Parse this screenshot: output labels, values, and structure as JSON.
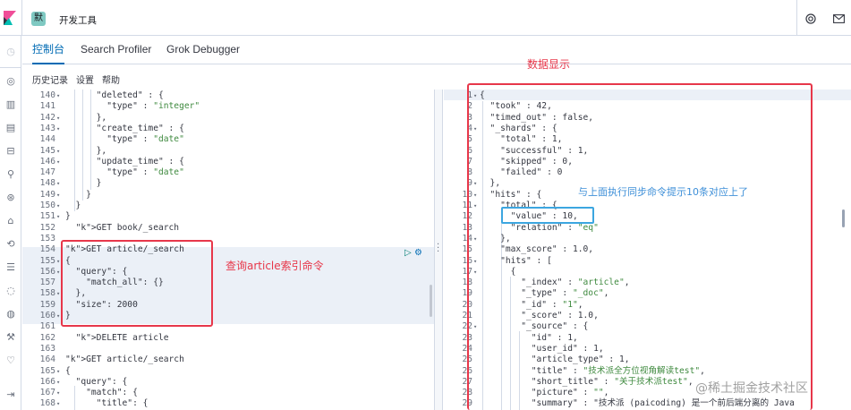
{
  "header": {
    "logo_icon": "kibana-logo-icon",
    "space_avatar": "默",
    "title": "开发工具",
    "help_icon": "help-lifebuoy-icon",
    "mail_icon": "mail-icon"
  },
  "tabs": [
    {
      "label": "控制台",
      "active": true
    },
    {
      "label": "Search Profiler",
      "active": false
    },
    {
      "label": "Grok Debugger",
      "active": false
    }
  ],
  "toolbar": {
    "history": "历史记录",
    "settings": "设置",
    "help": "帮助"
  },
  "left_editor": {
    "lines": [
      {
        "n": "140",
        "fold": true,
        "code": "      \"deleted\" : {"
      },
      {
        "n": "141",
        "fold": false,
        "code": "        \"type\" : \"integer\""
      },
      {
        "n": "142",
        "fold": true,
        "code": "      },"
      },
      {
        "n": "143",
        "fold": true,
        "code": "      \"create_time\" : {"
      },
      {
        "n": "144",
        "fold": false,
        "code": "        \"type\" : \"date\""
      },
      {
        "n": "145",
        "fold": true,
        "code": "      },"
      },
      {
        "n": "146",
        "fold": true,
        "code": "      \"update_time\" : {"
      },
      {
        "n": "147",
        "fold": false,
        "code": "        \"type\" : \"date\""
      },
      {
        "n": "148",
        "fold": true,
        "code": "      }"
      },
      {
        "n": "149",
        "fold": true,
        "code": "    }"
      },
      {
        "n": "150",
        "fold": true,
        "code": "  }"
      },
      {
        "n": "151",
        "fold": true,
        "code": "}"
      },
      {
        "n": "152",
        "fold": false,
        "code": "  GET book/_search"
      },
      {
        "n": "153",
        "fold": false,
        "code": ""
      },
      {
        "n": "154",
        "fold": false,
        "code": "GET article/_search"
      },
      {
        "n": "155",
        "fold": true,
        "code": "{"
      },
      {
        "n": "156",
        "fold": true,
        "code": "  \"query\": {"
      },
      {
        "n": "157",
        "fold": false,
        "code": "    \"match_all\": {}"
      },
      {
        "n": "158",
        "fold": true,
        "code": "  },"
      },
      {
        "n": "159",
        "fold": false,
        "code": "  \"size\": 2000"
      },
      {
        "n": "160",
        "fold": true,
        "code": "}"
      },
      {
        "n": "161",
        "fold": false,
        "code": ""
      },
      {
        "n": "162",
        "fold": false,
        "code": "  DELETE article"
      },
      {
        "n": "163",
        "fold": false,
        "code": ""
      },
      {
        "n": "164",
        "fold": false,
        "code": "GET article/_search"
      },
      {
        "n": "165",
        "fold": true,
        "code": "{"
      },
      {
        "n": "166",
        "fold": true,
        "code": "  \"query\": {"
      },
      {
        "n": "167",
        "fold": true,
        "code": "    \"match\": {"
      },
      {
        "n": "168",
        "fold": true,
        "code": "      \"title\": {"
      }
    ]
  },
  "right_editor": {
    "lines": [
      {
        "n": "1",
        "fold": true,
        "code": "{"
      },
      {
        "n": "2",
        "fold": false,
        "code": "  \"took\" : 42,"
      },
      {
        "n": "3",
        "fold": false,
        "code": "  \"timed_out\" : false,"
      },
      {
        "n": "4",
        "fold": true,
        "code": "  \"_shards\" : {"
      },
      {
        "n": "5",
        "fold": false,
        "code": "    \"total\" : 1,"
      },
      {
        "n": "6",
        "fold": false,
        "code": "    \"successful\" : 1,"
      },
      {
        "n": "7",
        "fold": false,
        "code": "    \"skipped\" : 0,"
      },
      {
        "n": "8",
        "fold": false,
        "code": "    \"failed\" : 0"
      },
      {
        "n": "9",
        "fold": true,
        "code": "  },"
      },
      {
        "n": "10",
        "fold": true,
        "code": "  \"hits\" : {"
      },
      {
        "n": "11",
        "fold": true,
        "code": "    \"total\" : {"
      },
      {
        "n": "12",
        "fold": false,
        "code": "      \"value\" : 10,"
      },
      {
        "n": "13",
        "fold": false,
        "code": "      \"relation\" : \"eq\""
      },
      {
        "n": "14",
        "fold": true,
        "code": "    },"
      },
      {
        "n": "15",
        "fold": false,
        "code": "    \"max_score\" : 1.0,"
      },
      {
        "n": "16",
        "fold": true,
        "code": "    \"hits\" : ["
      },
      {
        "n": "17",
        "fold": true,
        "code": "      {"
      },
      {
        "n": "18",
        "fold": false,
        "code": "        \"_index\" : \"article\","
      },
      {
        "n": "19",
        "fold": false,
        "code": "        \"_type\" : \"_doc\","
      },
      {
        "n": "20",
        "fold": false,
        "code": "        \"_id\" : \"1\","
      },
      {
        "n": "21",
        "fold": false,
        "code": "        \"_score\" : 1.0,"
      },
      {
        "n": "22",
        "fold": true,
        "code": "        \"_source\" : {"
      },
      {
        "n": "23",
        "fold": false,
        "code": "          \"id\" : 1,"
      },
      {
        "n": "24",
        "fold": false,
        "code": "          \"user_id\" : 1,"
      },
      {
        "n": "25",
        "fold": false,
        "code": "          \"article_type\" : 1,"
      },
      {
        "n": "26",
        "fold": false,
        "code": "          \"title\" : \"技术派全方位视角解读test\","
      },
      {
        "n": "27",
        "fold": false,
        "code": "          \"short_title\" : \"关于技术派test\","
      },
      {
        "n": "28",
        "fold": false,
        "code": "          \"picture\" : \"\","
      },
      {
        "n": "29",
        "fold": false,
        "code": "          \"summary\" : \"技术派 (paicoding) 是一个前后端分离的 Java"
      }
    ]
  },
  "annotations": {
    "data_display": "数据显示",
    "query_command": "查询article索引命令",
    "sync_note": "与上面执行同步命令提示10条对应上了"
  },
  "watermark": "@稀土掘金技术社区",
  "colors": {
    "active_tab": "#006bb4",
    "annotation_red": "#e7374a",
    "annotation_blue": "#3ca6e0",
    "string": "#3f8a3f",
    "keyword": "#b91e70"
  }
}
